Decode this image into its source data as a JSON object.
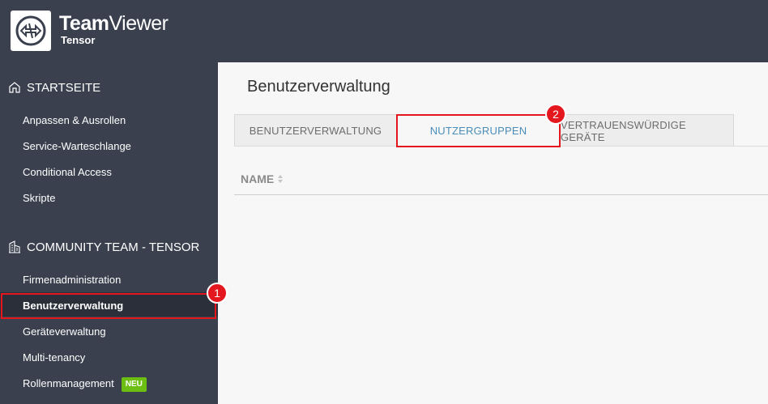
{
  "brand": {
    "name_bold": "Team",
    "name_rest": "Viewer",
    "product": "Tensor"
  },
  "sidebar": {
    "home_section": "STARTSEITE",
    "home_items": [
      "Anpassen & Ausrollen",
      "Service-Warteschlange",
      "Conditional Access",
      "Skripte"
    ],
    "company_section": "COMMUNITY TEAM - TENSOR",
    "company_items": [
      "Firmenadministration",
      "Benutzerverwaltung",
      "Geräteverwaltung",
      "Multi-tenancy",
      "Rollenmanagement"
    ],
    "badge": "NEU",
    "active_item": "Benutzerverwaltung"
  },
  "main": {
    "title": "Benutzerverwaltung",
    "tabs": [
      {
        "label": "BENUTZERVERWALTUNG",
        "active": false
      },
      {
        "label": "NUTZERGRUPPEN",
        "active": true
      },
      {
        "label": "VERTRAUENSWÜRDIGE GERÄTE",
        "active": false
      }
    ],
    "column_header": "NAME"
  },
  "markers": {
    "one": "1",
    "two": "2"
  },
  "colors": {
    "topbar": "#3a404e",
    "accent_red": "#e3171d",
    "active_tab": "#4a8db8",
    "badge_green": "#6cbf12"
  },
  "icons": {
    "logo": "teamviewer-logo-icon",
    "home": "home-icon",
    "company": "building-icon",
    "sort": "sort-icon"
  }
}
